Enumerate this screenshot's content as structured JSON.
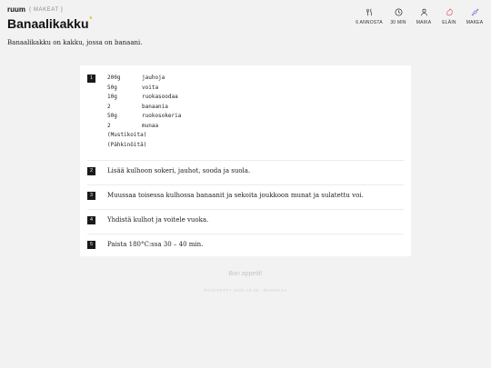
{
  "header": {
    "logo": "ruum",
    "breadcrumb": "{ MAKEAT }",
    "title": "Banaalikakku",
    "title_star": "*",
    "description": "Banaalikakku on kakku, jossa on banaani."
  },
  "meta": [
    {
      "label": "6 ANNOSTA",
      "icon": "fork-knife-icon"
    },
    {
      "label": "30 MIN",
      "icon": "clock-icon"
    },
    {
      "label": "MAIKA",
      "icon": "person-icon"
    },
    {
      "label": "ELÄIN",
      "icon": "chicken-icon"
    },
    {
      "label": "MAKEA",
      "icon": "candy-icon"
    }
  ],
  "accent_colors": {
    "star": "#e9b000",
    "animal": "#e05a6a",
    "sweet": "#7a6fd8"
  },
  "steps": [
    {
      "number": "1",
      "ingredients": [
        {
          "amount": "200g",
          "name": "jauhoja"
        },
        {
          "amount": "50g",
          "name": "voita"
        },
        {
          "amount": "10g",
          "name": "ruokasoodaa"
        },
        {
          "amount": "2",
          "name": "banaania"
        },
        {
          "amount": "50g",
          "name": "ruokosokeria"
        },
        {
          "amount": "2",
          "name": "munaa"
        },
        {
          "amount": "(Mustikoita)",
          "name": ""
        },
        {
          "amount": "(Pähkinöitä)",
          "name": ""
        }
      ]
    },
    {
      "number": "2",
      "text": "Lisää kulhoon sokeri, jauhot, sooda ja suola."
    },
    {
      "number": "3",
      "text": "Muussaa toisessa kulhossa banaanit ja sekoita joukkoon munat ja sulatettu voi."
    },
    {
      "number": "4",
      "text": "Yhdistä kulhot ja voitele vuoka."
    },
    {
      "number": "5",
      "text": "Paista 180°C:ssa 30 – 40 min."
    }
  ],
  "footer": {
    "greeting": "Bon appetit!",
    "published": "PÄIVITETTY 2020-12-16 · RUOKAAA"
  }
}
